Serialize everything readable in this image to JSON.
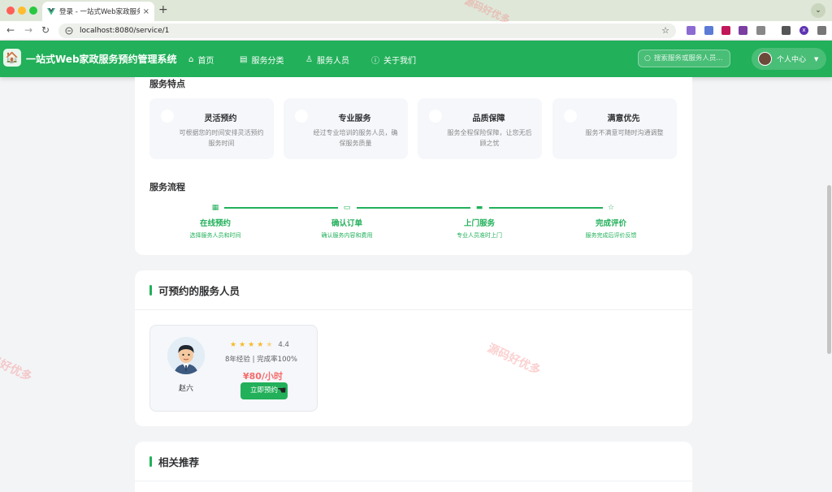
{
  "browser": {
    "tab_title": "登录 - 一站式Web家政服务预约",
    "tab_close": "×",
    "new_tab": "+",
    "url": "localhost:8080/service/1",
    "profile_initial": "x",
    "icons": {
      "back": "←",
      "forward": "→",
      "reload": "↻",
      "star": "☆"
    },
    "traffic_colors": [
      "#ff5f57",
      "#febc2e",
      "#28c840"
    ]
  },
  "app": {
    "title": "一站式Web家政服务预约管理系统",
    "nav": [
      {
        "label": "首页",
        "icon": "home-icon"
      },
      {
        "label": "服务分类",
        "icon": "category-icon"
      },
      {
        "label": "服务人员",
        "icon": "user-icon"
      },
      {
        "label": "关于我们",
        "icon": "info-icon"
      }
    ],
    "search_placeholder": "搜索服务或服务人员...",
    "user_menu_label": "个人中心",
    "brand_color": "#22b05a"
  },
  "features": {
    "title": "服务特点",
    "items": [
      {
        "title": "灵活预约",
        "desc": "可根据您的时间安排灵活预约服务时间"
      },
      {
        "title": "专业服务",
        "desc": "经过专业培训的服务人员，确保服务质量"
      },
      {
        "title": "品质保障",
        "desc": "服务全程保险保障，让您无后顾之忧"
      },
      {
        "title": "满意优先",
        "desc": "服务不满意可随时沟通调整"
      }
    ]
  },
  "process": {
    "title": "服务流程",
    "steps": [
      {
        "title": "在线预约",
        "desc": "选择服务人员和时间",
        "icon": "calendar-icon"
      },
      {
        "title": "确认订单",
        "desc": "确认服务内容和费用",
        "icon": "document-icon"
      },
      {
        "title": "上门服务",
        "desc": "专业人员准时上门",
        "icon": "truck-icon"
      },
      {
        "title": "完成评价",
        "desc": "服务完成后评价反馈",
        "icon": "star-outline-icon"
      }
    ]
  },
  "staff_section": {
    "title": "可预约的服务人员",
    "staff": [
      {
        "name": "赵六",
        "rating": 4.4,
        "rating_text": "4.4",
        "meta": "8年经验 | 完成率100%",
        "price": "¥80/小时",
        "book_label": "立即预约"
      }
    ]
  },
  "related": {
    "title": "相关推荐"
  },
  "watermark": "源码好优多"
}
